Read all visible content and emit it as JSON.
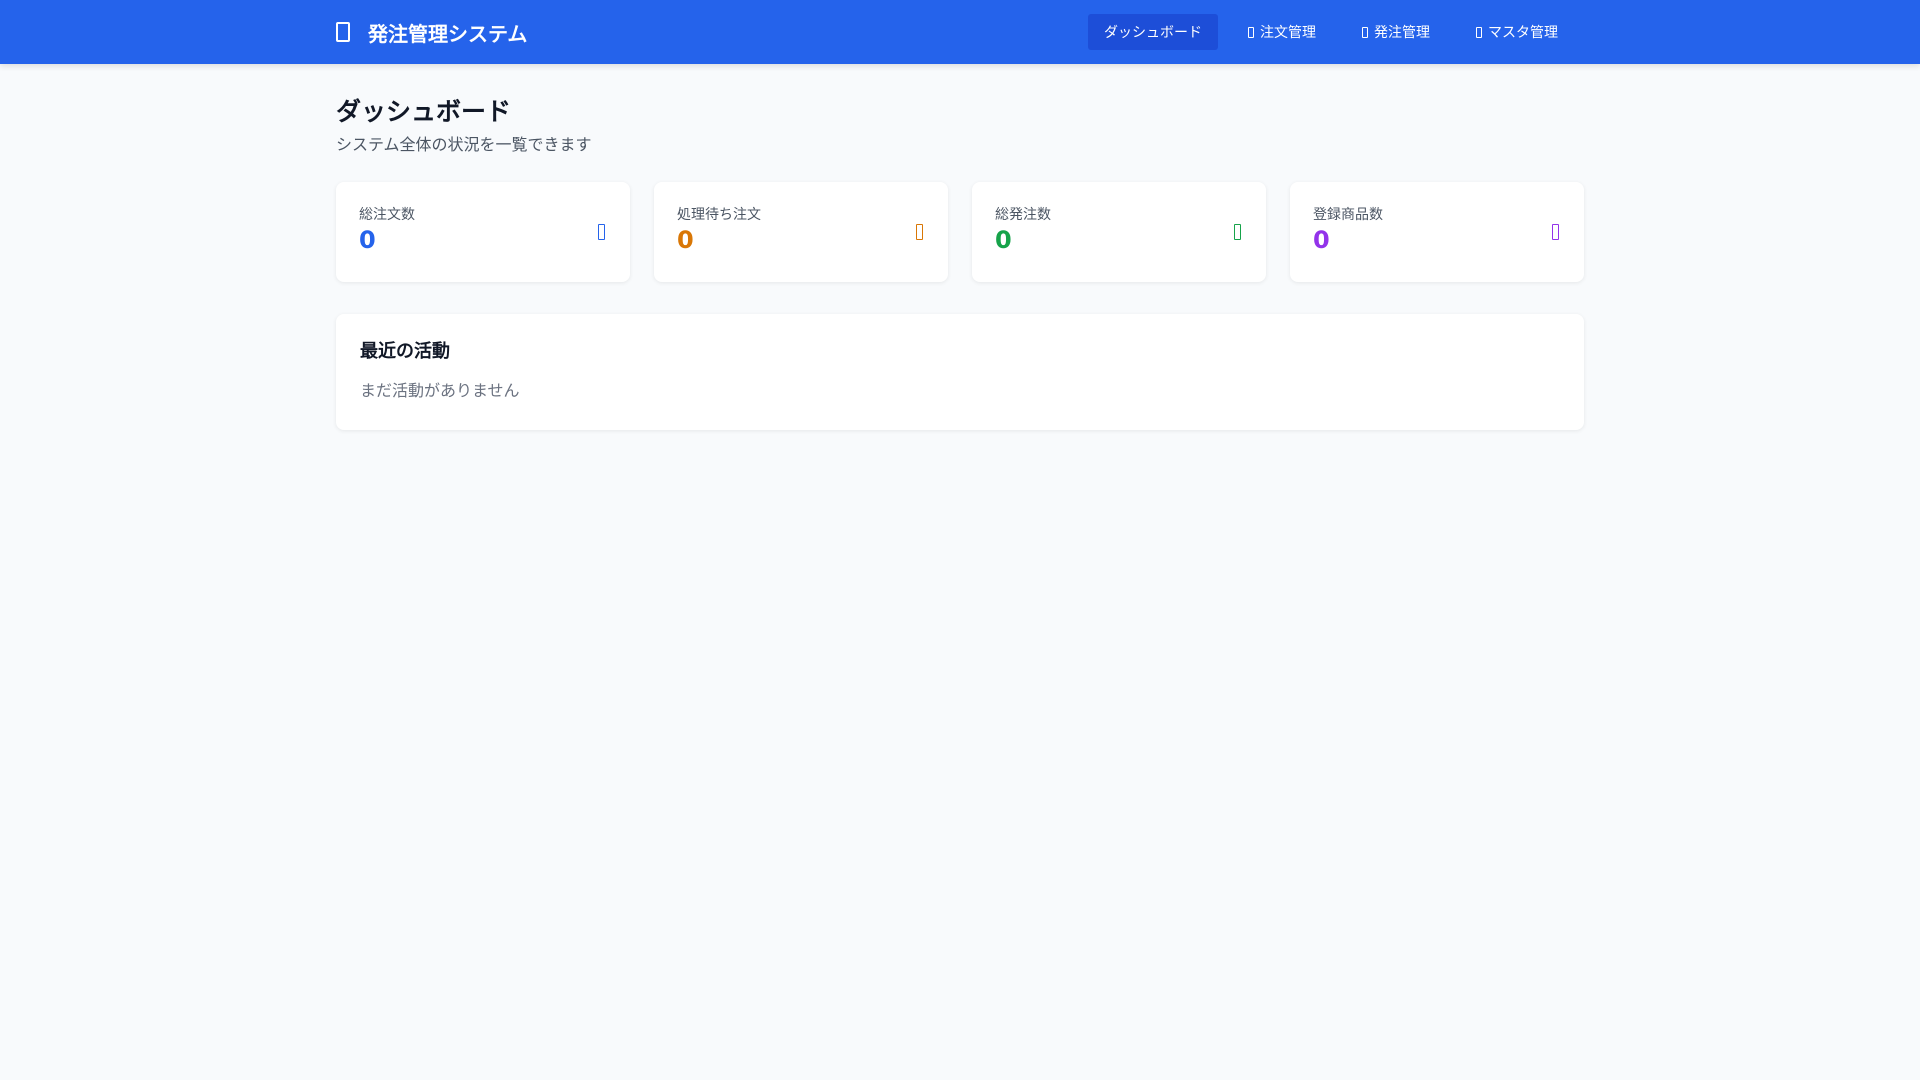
{
  "header": {
    "brand_icon": "box-icon",
    "title": "発注管理システム",
    "background": "#2563eb",
    "nav": [
      {
        "label": "ダッシュボード",
        "active": true,
        "icon": ""
      },
      {
        "label": "注文管理",
        "active": false,
        "icon": "cart-icon"
      },
      {
        "label": "発注管理",
        "active": false,
        "icon": "truck-icon"
      },
      {
        "label": "マスタ管理",
        "active": false,
        "icon": "database-icon"
      }
    ]
  },
  "main": {
    "title": "ダッシュボード",
    "subtitle": "システム全体の状況を一覧できます",
    "stats": [
      {
        "label": "総注文数",
        "value": "0",
        "color": "#2563eb",
        "icon": "cart-icon"
      },
      {
        "label": "処理待ち注文",
        "value": "0",
        "color": "#d97706",
        "icon": "clock-icon"
      },
      {
        "label": "総発注数",
        "value": "0",
        "color": "#16a34a",
        "icon": "truck-icon"
      },
      {
        "label": "登録商品数",
        "value": "0",
        "color": "#9333ea",
        "icon": "box-icon"
      }
    ],
    "activity": {
      "title": "最近の活動",
      "empty_text": "まだ活動がありません"
    }
  }
}
